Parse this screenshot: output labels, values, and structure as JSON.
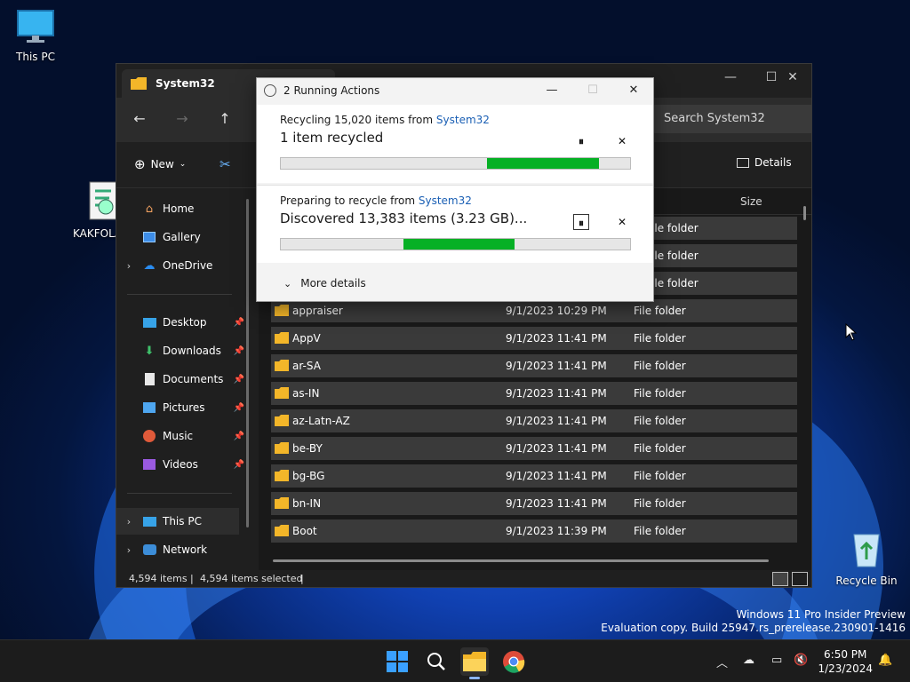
{
  "desktop": {
    "icons": [
      {
        "name": "this-pc",
        "label": "This PC"
      },
      {
        "name": "kakfola",
        "label": "KAKFOLA"
      },
      {
        "name": "recycle-bin",
        "label": "Recycle Bin"
      }
    ],
    "watermark": {
      "line1": "Windows 11 Pro Insider Preview",
      "line2": "Evaluation copy. Build 25947.rs_prerelease.230901-1416"
    }
  },
  "explorer": {
    "tab_title": "System32",
    "search_placeholder": "Search System32",
    "toolbar": {
      "new_label": "New",
      "details_label": "Details"
    },
    "sidebar": {
      "top": [
        "Home",
        "Gallery",
        "OneDrive"
      ],
      "pinned": [
        "Desktop",
        "Downloads",
        "Documents",
        "Pictures",
        "Music",
        "Videos"
      ],
      "bottom": [
        "This PC",
        "Network"
      ]
    },
    "columns": {
      "size": "Size"
    },
    "partial_rows": [
      "File folder",
      "File folder",
      "File folder"
    ],
    "rows": [
      {
        "name": "appraiser",
        "date": "9/1/2023 10:29 PM",
        "type": "File folder"
      },
      {
        "name": "AppV",
        "date": "9/1/2023 11:41 PM",
        "type": "File folder"
      },
      {
        "name": "ar-SA",
        "date": "9/1/2023 11:41 PM",
        "type": "File folder"
      },
      {
        "name": "as-IN",
        "date": "9/1/2023 11:41 PM",
        "type": "File folder"
      },
      {
        "name": "az-Latn-AZ",
        "date": "9/1/2023 11:41 PM",
        "type": "File folder"
      },
      {
        "name": "be-BY",
        "date": "9/1/2023 11:41 PM",
        "type": "File folder"
      },
      {
        "name": "bg-BG",
        "date": "9/1/2023 11:41 PM",
        "type": "File folder"
      },
      {
        "name": "bn-IN",
        "date": "9/1/2023 11:41 PM",
        "type": "File folder"
      },
      {
        "name": "Boot",
        "date": "9/1/2023 11:39 PM",
        "type": "File folder"
      }
    ],
    "status": {
      "items": "4,594 items",
      "selected": "4,594 items selected"
    }
  },
  "dialog": {
    "title": "2 Running Actions",
    "action1": {
      "prefix": "Recycling 15,020 items from ",
      "link": "System32",
      "detail": "1 item recycled",
      "progress": {
        "start": 0.59,
        "end": 0.91
      }
    },
    "action2": {
      "prefix": "Preparing to recycle from ",
      "link": "System32",
      "detail": "Discovered 13,383 items (3.23 GB)...",
      "progress": {
        "start": 0.35,
        "end": 0.67
      }
    },
    "more_details": "More details"
  },
  "taskbar": {
    "time": "6:50 PM",
    "date": "1/23/2024"
  }
}
